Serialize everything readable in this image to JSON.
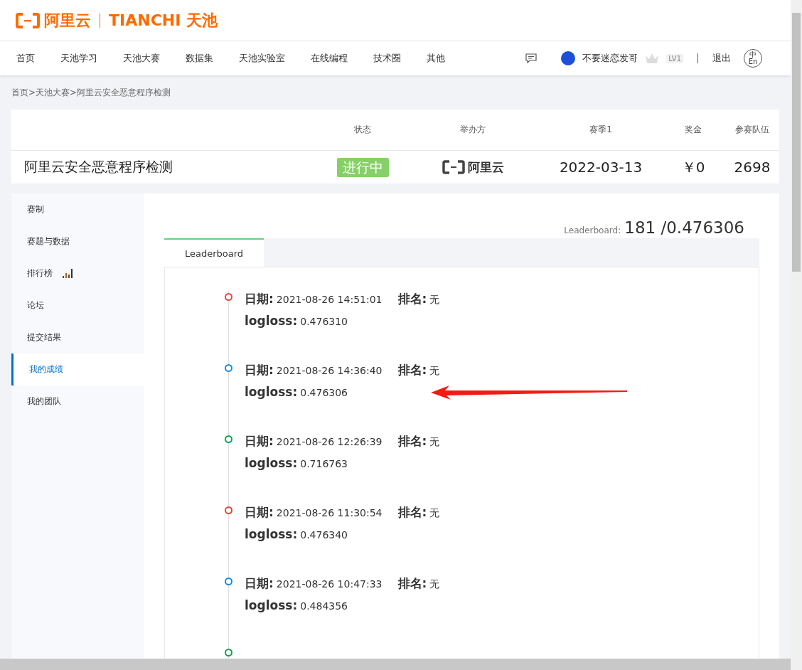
{
  "header": {
    "logo_brand": "阿里云",
    "logo_product": "TIANCHI 天池"
  },
  "nav": {
    "items": [
      {
        "label": "首页",
        "selected": false
      },
      {
        "label": "天池学习",
        "selected": false
      },
      {
        "label": "天池大赛",
        "selected": false
      },
      {
        "label": "数据集",
        "selected": false
      },
      {
        "label": "天池实验室",
        "selected": false
      },
      {
        "label": "在线编程",
        "selected": false
      },
      {
        "label": "技术圈",
        "selected": false
      },
      {
        "label": "其他",
        "selected": false
      }
    ],
    "user_name": "不要迷恋发哥",
    "level_badge": "LV1",
    "logout": "退出",
    "language_toggle": {
      "top": "中",
      "bottom": "En"
    }
  },
  "breadcrumb": "首页>天池大赛>阿里云安全恶意程序检测",
  "competition": {
    "columns": [
      "状态",
      "举办方",
      "赛季1",
      "奖金",
      "参赛队伍"
    ],
    "name": "阿里云安全恶意程序检测",
    "status": "进行中",
    "organizer": "阿里云",
    "season_date": "2022-03-13",
    "prize": "￥0",
    "teams": "2698"
  },
  "sidebar": {
    "items": [
      {
        "label": "赛制",
        "selected": false,
        "kind": "text"
      },
      {
        "label": "赛题与数据",
        "selected": false,
        "kind": "text"
      },
      {
        "label": "排行榜",
        "selected": false,
        "kind": "chart"
      },
      {
        "label": "论坛",
        "selected": false,
        "kind": "text"
      },
      {
        "label": "提交结果",
        "selected": false,
        "kind": "text"
      },
      {
        "label": "我的成绩",
        "selected": true,
        "kind": "text"
      },
      {
        "label": "我的团队",
        "selected": false,
        "kind": "text"
      }
    ]
  },
  "score": {
    "label": "Leaderboard:",
    "value": "181 /0.476306"
  },
  "tabs": [
    {
      "label": "Leaderboard",
      "selected": true
    }
  ],
  "submissions": [
    {
      "color": "#f04134",
      "date_label": "日期:",
      "date": "2021-08-26 14:51:01",
      "rank_label": "排名:",
      "rank": "无",
      "metric_label": "logloss:",
      "metric": "0.476310"
    },
    {
      "color": "#108ee9",
      "date_label": "日期:",
      "date": "2021-08-26 14:36:40",
      "rank_label": "排名:",
      "rank": "无",
      "metric_label": "logloss:",
      "metric": "0.476306"
    },
    {
      "color": "#00a854",
      "date_label": "日期:",
      "date": "2021-08-26 12:26:39",
      "rank_label": "排名:",
      "rank": "无",
      "metric_label": "logloss:",
      "metric": "0.716763"
    },
    {
      "color": "#f04134",
      "date_label": "日期:",
      "date": "2021-08-26 11:30:54",
      "rank_label": "排名:",
      "rank": "无",
      "metric_label": "logloss:",
      "metric": "0.476340"
    },
    {
      "color": "#108ee9",
      "date_label": "日期:",
      "date": "2021-08-26 10:47:33",
      "rank_label": "排名:",
      "rank": "无",
      "metric_label": "logloss:",
      "metric": "0.484356"
    },
    {
      "color": "#00a854"
    }
  ]
}
